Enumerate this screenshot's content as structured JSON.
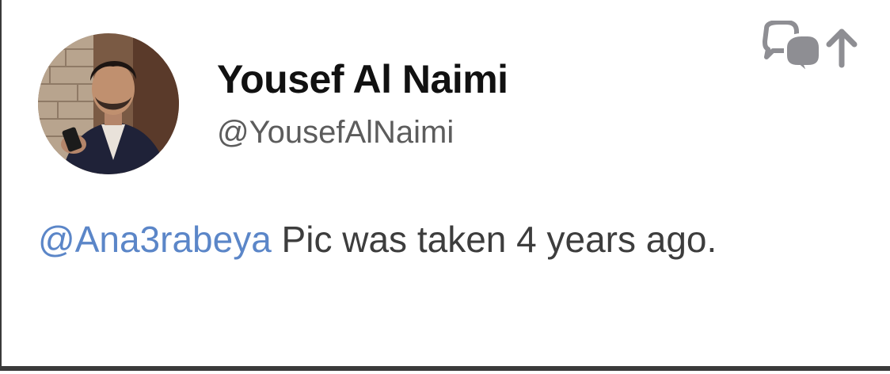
{
  "tweet": {
    "author": {
      "display_name": "Yousef Al Naimi",
      "handle": "@YousefAlNaimi",
      "avatar_icon": "profile-photo"
    },
    "actions": {
      "conversation_icon": "conversation-icon",
      "share_icon": "share-up-arrow-icon"
    },
    "body": {
      "mention": "@Ana3rabeya",
      "text": " Pic was taken 4 years ago."
    },
    "colors": {
      "mention": "#5b86c8",
      "text": "#3d3d3d",
      "name": "#111111",
      "handle": "#5c5c5c",
      "icons": "#8e8e93"
    }
  }
}
